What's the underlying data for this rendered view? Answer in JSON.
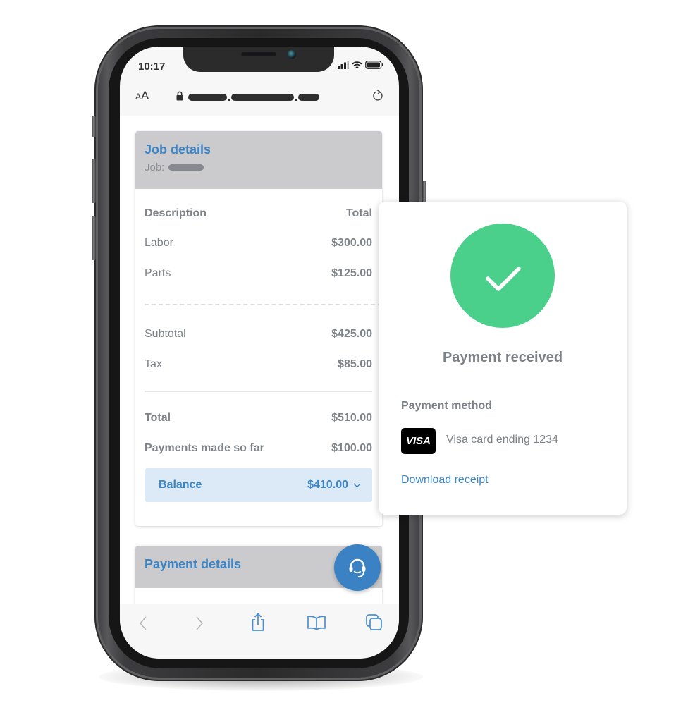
{
  "status_bar": {
    "time": "10:17",
    "icons": [
      "signal-icon",
      "wifi-icon",
      "battery-icon"
    ]
  },
  "browser": {
    "text_size_label_small": "A",
    "text_size_label_large": "A",
    "url_masked": true,
    "lock_icon": "lock-icon",
    "reload_icon": "reload-icon"
  },
  "job_card": {
    "title": "Job details",
    "job_label": "Job:",
    "columns": {
      "description": "Description",
      "total": "Total"
    },
    "line_items": [
      {
        "label": "Labor",
        "amount": "$300.00"
      },
      {
        "label": "Parts",
        "amount": "$125.00"
      }
    ],
    "subtotal": {
      "label": "Subtotal",
      "amount": "$425.00"
    },
    "tax": {
      "label": "Tax",
      "amount": "$85.00"
    },
    "total": {
      "label": "Total",
      "amount": "$510.00"
    },
    "payments": {
      "label": "Payments made so far",
      "amount": "$100.00"
    },
    "balance": {
      "label": "Balance",
      "amount": "$410.00"
    }
  },
  "payment_card": {
    "title": "Payment details"
  },
  "support_button": {
    "icon": "headset-icon"
  },
  "toolbar": {
    "icons": [
      "back-icon",
      "forward-icon",
      "share-icon",
      "bookmarks-icon",
      "tabs-icon"
    ]
  },
  "popup": {
    "status": "Payment received",
    "method_label": "Payment method",
    "card_brand": "VISA",
    "card_text": "Visa card ending 1234",
    "download_label": "Download receipt"
  },
  "colors": {
    "accent_blue": "#3b84c6",
    "success_green": "#4bd08c",
    "balance_bg": "#dceaf8",
    "header_gray": "#cbcbcd"
  }
}
